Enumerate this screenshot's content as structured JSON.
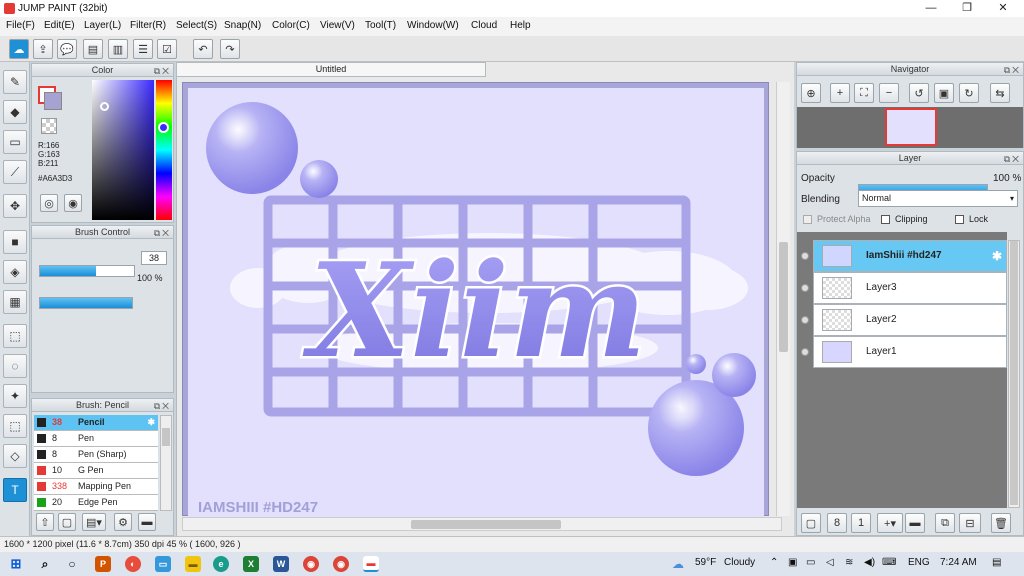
{
  "window": {
    "title": "JUMP PAINT (32bit)",
    "min": "—",
    "max": "❐",
    "close": "✕"
  },
  "menu": [
    "File(F)",
    "Edit(E)",
    "Layer(L)",
    "Filter(R)",
    "Select(S)",
    "Snap(N)",
    "Color(C)",
    "View(V)",
    "Tool(T)",
    "Window(W)",
    "Cloud",
    "Help"
  ],
  "colors": {
    "accent": "#1e90d6",
    "selection": "#5ec3f2",
    "canvas_bg": "#e2e0fc",
    "art_purple": "#8c87e6"
  },
  "color_panel": {
    "title": "Color",
    "r": "R:166",
    "g": "G:163",
    "b": "B:211",
    "hex": "#A6A3D3",
    "current_color": "#a6a3d3"
  },
  "brush_control": {
    "title": "Brush Control",
    "size": "38",
    "opacity": "100 %",
    "size_level": 0.6,
    "opacity_level": 1.0
  },
  "brush_list": {
    "title": "Brush: Pencil",
    "items": [
      {
        "size": "38",
        "name": "Pencil",
        "color": "#222",
        "size_color": "#e53935"
      },
      {
        "size": "8",
        "name": "Pen",
        "color": "#222",
        "size_color": "#222"
      },
      {
        "size": "8",
        "name": "Pen (Sharp)",
        "color": "#222",
        "size_color": "#222"
      },
      {
        "size": "10",
        "name": "G Pen",
        "color": "#e53935",
        "size_color": "#222"
      },
      {
        "size": "338",
        "name": "Mapping Pen",
        "color": "#e53935",
        "size_color": "#e53935"
      },
      {
        "size": "20",
        "name": "Edge Pen",
        "color": "#1aa31a",
        "size_color": "#222"
      }
    ]
  },
  "document": {
    "tab": "Untitled",
    "watermark": "IAMSHIII #HD247",
    "lettering": "Xiim"
  },
  "navigator": {
    "title": "Navigator"
  },
  "layer_panel": {
    "title": "Layer",
    "opacity_label": "Opacity",
    "opacity_value": "100 %",
    "blending_label": "Blending",
    "blending_value": "Normal",
    "protect_alpha": "Protect Alpha",
    "clipping": "Clipping",
    "lock": "Lock",
    "layers": [
      {
        "name": "IamShiii #hd247",
        "selected": true
      },
      {
        "name": "Layer3",
        "selected": false
      },
      {
        "name": "Layer2",
        "selected": false
      },
      {
        "name": "Layer1",
        "selected": false
      }
    ]
  },
  "status": {
    "text": "1600 * 1200 pixel  (11.6 * 8.7cm)  350 dpi  45 %  ( 1600, 926 )"
  },
  "taskbar": {
    "weather_temp": "59°F",
    "weather_desc": "Cloudy",
    "lang": "ENG",
    "time": "7:24 AM"
  }
}
